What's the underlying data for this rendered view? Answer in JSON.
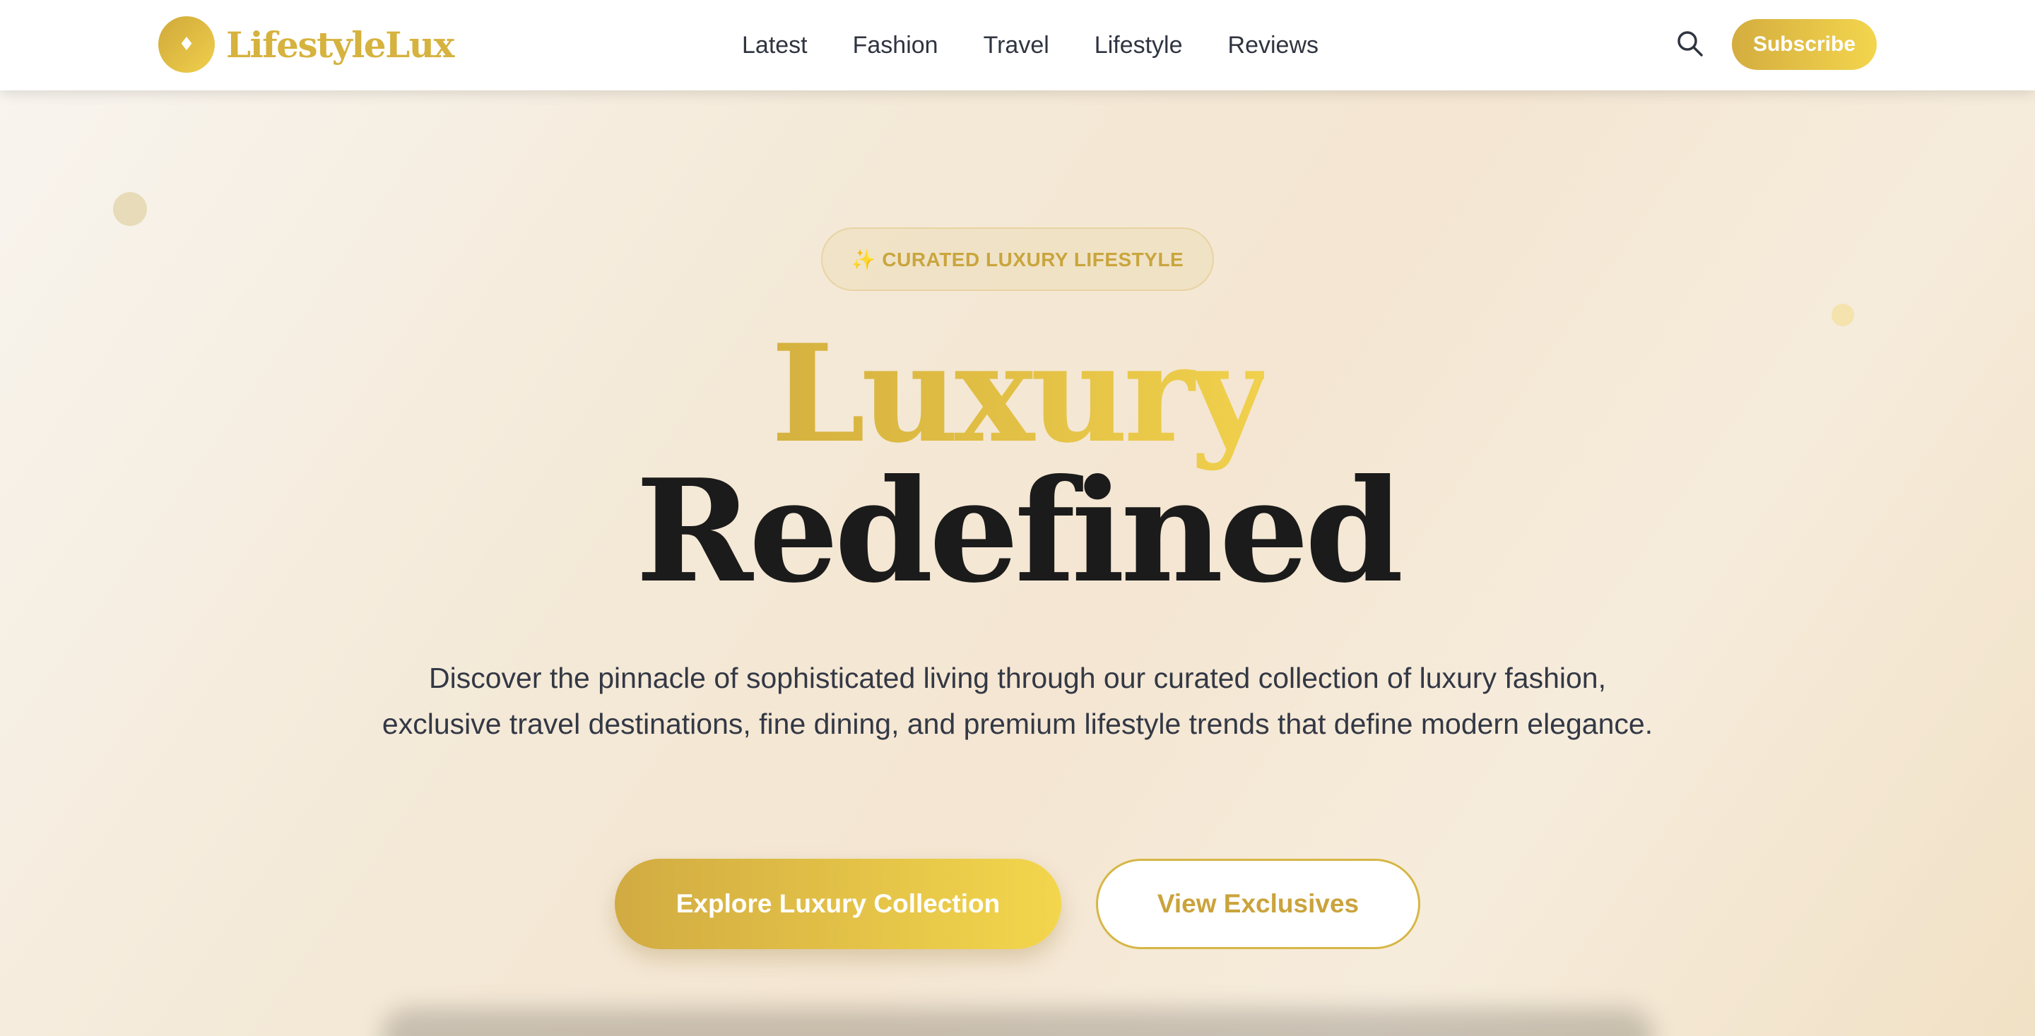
{
  "brand": {
    "name": "LifestyleLux",
    "logo_glyph": "♦"
  },
  "nav": {
    "items": [
      {
        "label": "Latest"
      },
      {
        "label": "Fashion"
      },
      {
        "label": "Travel"
      },
      {
        "label": "Lifestyle"
      },
      {
        "label": "Reviews"
      }
    ]
  },
  "header": {
    "search_icon": "search-icon",
    "subscribe_label": "Subscribe"
  },
  "hero": {
    "badge": "✨ CURATED LUXURY LIFESTYLE",
    "title_line1": "Luxury",
    "title_line2": "Redefined",
    "description": "Discover the pinnacle of sophisticated living through our curated collection of luxury fashion, exclusive travel destinations, fine dining, and premium lifestyle trends that define modern elegance.",
    "primary_cta": "Explore Luxury Collection",
    "secondary_cta": "View Exclusives"
  },
  "colors": {
    "accent_gold": "#d6b23e",
    "accent_gold_light": "#f3d54d",
    "text_dark": "#1b1b1b",
    "background": "#f5ede0"
  }
}
